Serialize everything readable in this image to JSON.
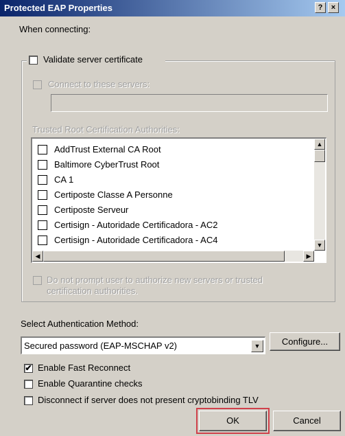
{
  "window": {
    "title": "Protected EAP Properties",
    "help_label": "?",
    "close_label": "×"
  },
  "when_connecting": "When connecting:",
  "validate_server_certificate": {
    "label": "Validate server certificate",
    "checked": false
  },
  "connect_to_servers": {
    "label": "Connect to these servers:",
    "checked": false,
    "enabled": false,
    "value": ""
  },
  "trusted_root_label": "Trusted Root Certification Authorities:",
  "trusted_roots": [
    {
      "label": "AddTrust External CA Root",
      "checked": false
    },
    {
      "label": "Baltimore CyberTrust Root",
      "checked": false
    },
    {
      "label": "CA 1",
      "checked": false
    },
    {
      "label": "Certiposte Classe A Personne",
      "checked": false
    },
    {
      "label": "Certiposte Serveur",
      "checked": false
    },
    {
      "label": "Certisign - Autoridade Certificadora - AC2",
      "checked": false
    },
    {
      "label": "Certisign - Autoridade Certificadora - AC4",
      "checked": false
    }
  ],
  "do_not_prompt": {
    "label_line1": "Do not prompt user to authorize new servers or trusted",
    "label_line2": "certification authorities.",
    "checked": false,
    "enabled": false
  },
  "select_auth_method_label": "Select Authentication Method:",
  "auth_method": {
    "selected": "Secured password (EAP-MSCHAP v2)"
  },
  "configure_label": "Configure...",
  "enable_fast_reconnect": {
    "label": "Enable Fast Reconnect",
    "checked": true
  },
  "enable_quarantine": {
    "label": "Enable Quarantine checks",
    "checked": false
  },
  "disconnect_cryptobinding": {
    "label": "Disconnect if server does not present cryptobinding TLV",
    "checked": false
  },
  "ok_label": "OK",
  "cancel_label": "Cancel",
  "check_mark": "✔",
  "colors": {
    "title_start": "#0a246a",
    "title_end": "#a6caf0",
    "highlight": "#d0404a",
    "face": "#d4d0c8"
  }
}
